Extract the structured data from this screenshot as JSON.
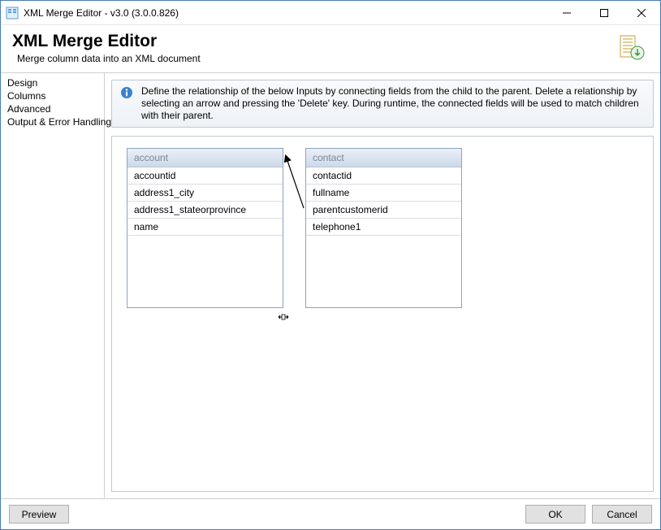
{
  "window": {
    "title": "XML Merge Editor - v3.0 (3.0.0.826)"
  },
  "header": {
    "title": "XML Merge Editor",
    "subtitle": "Merge column data into an XML document"
  },
  "sidebar": {
    "items": [
      "Design",
      "Columns",
      "Advanced",
      "Output & Error Handling"
    ]
  },
  "info_banner": "Define the relationship of the below Inputs by connecting fields from the child to the parent. Delete a relationship by selecting an arrow and pressing the 'Delete' key. During runtime, the connected fields will be used to match children with their parent.",
  "canvas": {
    "entities": [
      {
        "name": "account",
        "fields": [
          "accountid",
          "address1_city",
          "address1_stateorprovince",
          "name"
        ]
      },
      {
        "name": "contact",
        "fields": [
          "contactid",
          "fullname",
          "parentcustomerid",
          "telephone1"
        ]
      }
    ]
  },
  "footer": {
    "preview": "Preview",
    "ok": "OK",
    "cancel": "Cancel"
  }
}
